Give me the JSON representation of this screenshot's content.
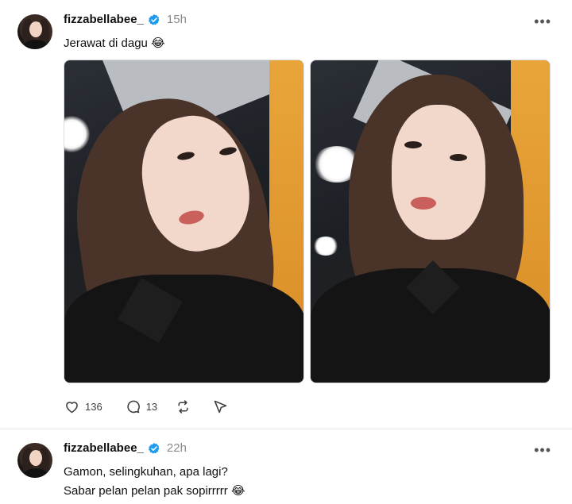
{
  "posts": [
    {
      "username": "fizzabellabee_",
      "time": "15h",
      "text": "Jerawat di dagu 😂",
      "likes": "136",
      "comments": "13"
    },
    {
      "username": "fizzabellabee_",
      "time": "22h",
      "text_line1": "Gamon, selingkuhan, apa lagi?",
      "text_line2": "Sabar pelan pelan pak sopirrrrr 😂"
    }
  ],
  "colors": {
    "verified": "#1d9bf0",
    "muted": "#8a8a8a",
    "text": "#101010"
  },
  "icons": [
    "verified-icon",
    "more-icon",
    "heart-icon",
    "comment-icon",
    "repost-icon",
    "share-icon"
  ]
}
